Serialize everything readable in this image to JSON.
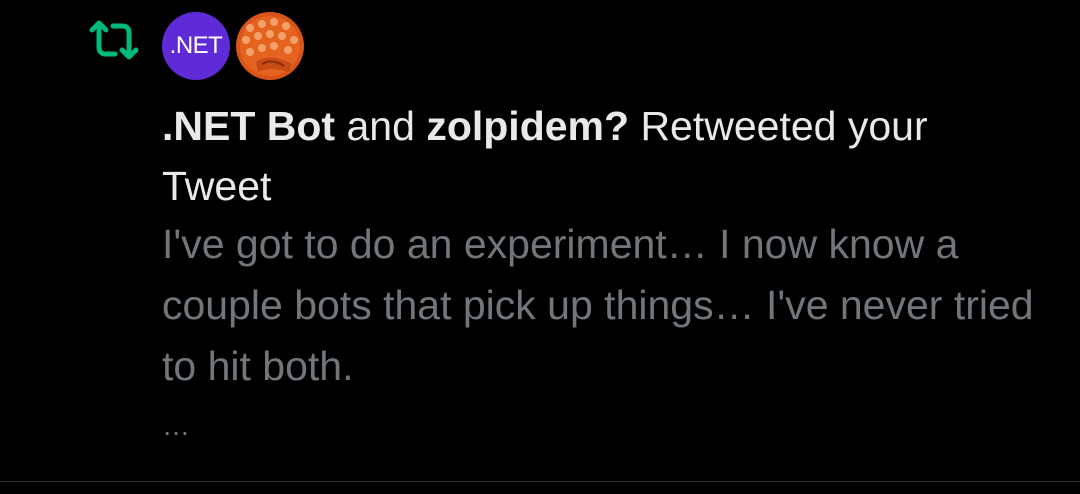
{
  "notification": {
    "type_icon": "retweet-icon",
    "accent_color": "#00ba7c",
    "avatars": [
      {
        "name": "net-bot-avatar",
        "text": ".NET",
        "color": "#5f2bd6"
      },
      {
        "name": "zolpidem-avatar",
        "color": "#e4631f"
      }
    ],
    "user1": ".NET Bot",
    "connector": "and",
    "user2": "zolpidem?",
    "action": "Retweeted your Tweet",
    "tweet_text": "I've got to do an experiment… I now know a couple bots that pick up things… I've never tried to hit both.",
    "more": "…"
  }
}
